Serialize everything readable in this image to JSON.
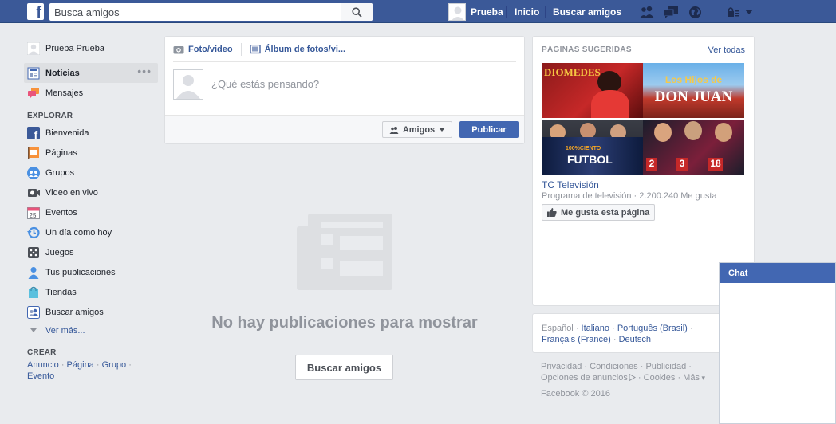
{
  "topbar": {
    "logo_letter": "f",
    "search_placeholder": "Busca amigos",
    "user_name": "Prueba",
    "home": "Inicio",
    "find_friends": "Buscar amigos"
  },
  "left_nav": {
    "profile_name": "Prueba Prueba",
    "main": [
      {
        "label": "Noticias",
        "icon": "news-feed-icon"
      },
      {
        "label": "Mensajes",
        "icon": "messages-icon"
      }
    ],
    "explore_header": "EXPLORAR",
    "explore": [
      {
        "label": "Bienvenida",
        "icon": "facebook-icon"
      },
      {
        "label": "Páginas",
        "icon": "pages-flag-icon"
      },
      {
        "label": "Grupos",
        "icon": "groups-icon"
      },
      {
        "label": "Video en vivo",
        "icon": "live-video-icon"
      },
      {
        "label": "Eventos",
        "icon": "calendar-icon"
      },
      {
        "label": "Un día como hoy",
        "icon": "on-this-day-icon"
      },
      {
        "label": "Juegos",
        "icon": "games-icon"
      },
      {
        "label": "Tus publicaciones",
        "icon": "person-icon"
      },
      {
        "label": "Tiendas",
        "icon": "shop-bag-icon"
      },
      {
        "label": "Buscar amigos",
        "icon": "find-friends-icon"
      }
    ],
    "see_more": "Ver más...",
    "create_header": "CREAR",
    "create_links": [
      "Anuncio",
      "Página",
      "Grupo",
      "Evento"
    ]
  },
  "composer": {
    "tab_photo": "Foto/video",
    "tab_album": "Álbum de fotos/vi...",
    "placeholder": "¿Qué estás pensando?",
    "audience": "Amigos",
    "publish": "Publicar"
  },
  "feed": {
    "empty_title": "No hay publicaciones para mostrar",
    "find_friends_button": "Buscar amigos"
  },
  "suggested": {
    "header": "PÁGINAS SUGERIDAS",
    "see_all": "Ver todas",
    "tile_texts": [
      "DIOMEDES",
      "Los Hijos de",
      "DON JUAN",
      "100%CIENTO",
      "FUTBOL",
      "2",
      "3",
      "18"
    ],
    "page_name": "TC Televisión",
    "page_meta": "Programa de televisión · 2.200.240 Me gusta",
    "like_button": "Me gusta esta página"
  },
  "languages": {
    "current": "Español",
    "links": [
      "Italiano",
      "Português (Brasil)",
      "Français (France)",
      "Deutsch"
    ]
  },
  "footer": {
    "links": [
      "Privacidad",
      "Condiciones",
      "Publicidad",
      "Opciones de anuncios",
      "Cookies",
      "Más"
    ],
    "copyright": "Facebook © 2016"
  },
  "chat": {
    "title": "Chat"
  },
  "colors": {
    "brand": "#3b5998",
    "button": "#4267b2",
    "link": "#365899",
    "background": "#e9ebee"
  }
}
